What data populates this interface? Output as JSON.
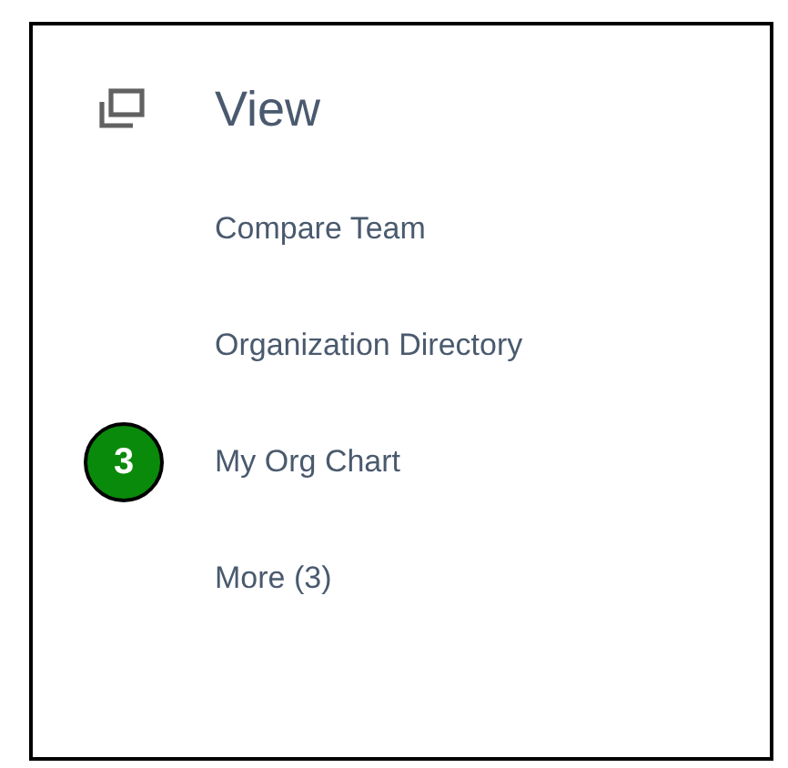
{
  "menu": {
    "title": "View",
    "items": [
      {
        "label": "Compare Team"
      },
      {
        "label": "Organization Directory"
      },
      {
        "label": "My Org Chart",
        "callout": "3"
      },
      {
        "label": "More (3)"
      }
    ]
  }
}
